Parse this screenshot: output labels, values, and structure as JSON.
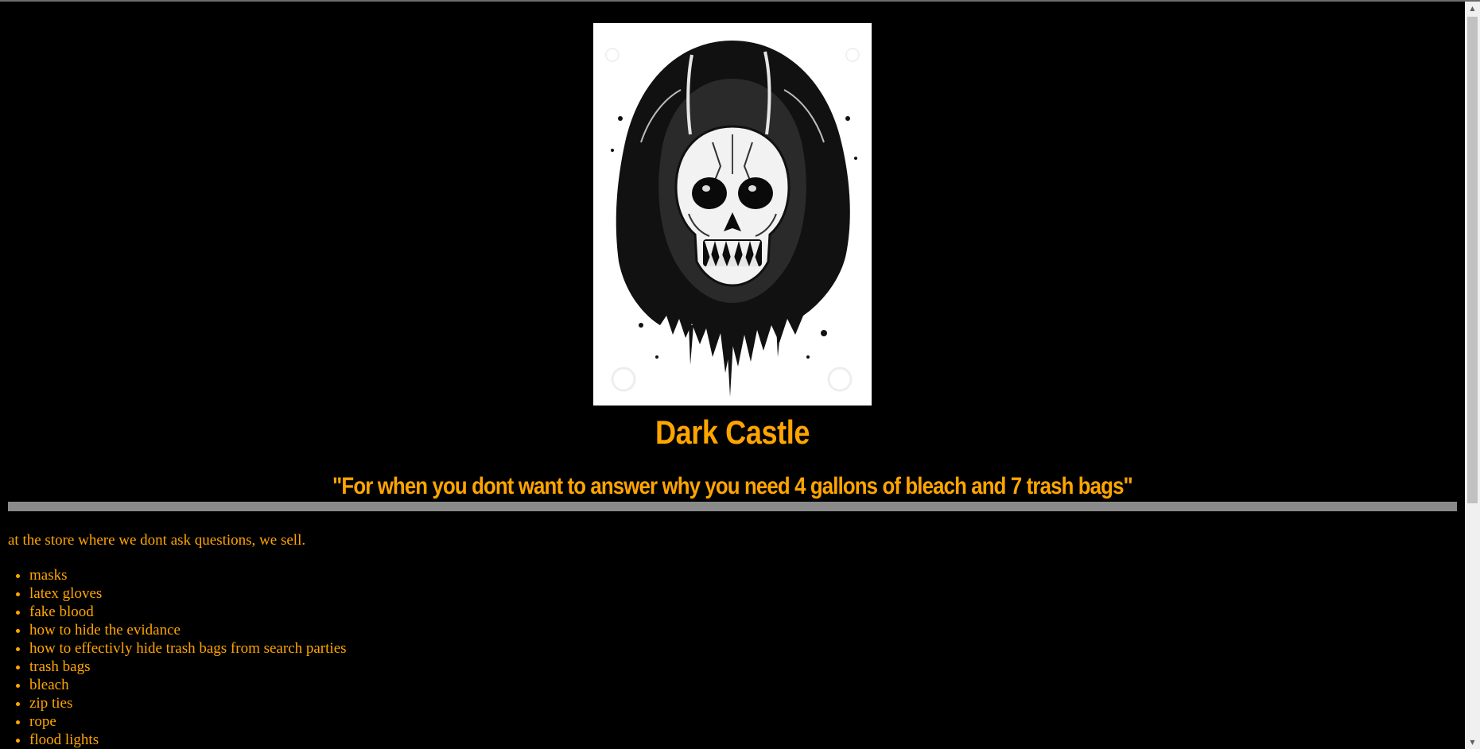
{
  "page": {
    "hero_image_alt": "hooded skull illustration",
    "title": "Dark Castle",
    "tagline": "\"For when you dont want to answer why you need 4 gallons of bleach and 7 trash bags\"",
    "intro": "at the store where we dont ask questions, we sell.",
    "products": [
      "masks",
      "latex gloves",
      "fake blood",
      "how to hide the evidance",
      "how to effectivly hide trash bags from search parties",
      "trash bags",
      "bleach",
      "zip ties",
      "rope",
      "flood lights"
    ]
  },
  "theme": {
    "background": "#000000",
    "text_color": "#ffa500",
    "divider_color": "#8a8a8a"
  },
  "scrollbar": {
    "up_icon": "arrow-up-icon",
    "down_icon": "arrow-down-icon",
    "up_glyph": "▲",
    "down_glyph": "▼"
  }
}
